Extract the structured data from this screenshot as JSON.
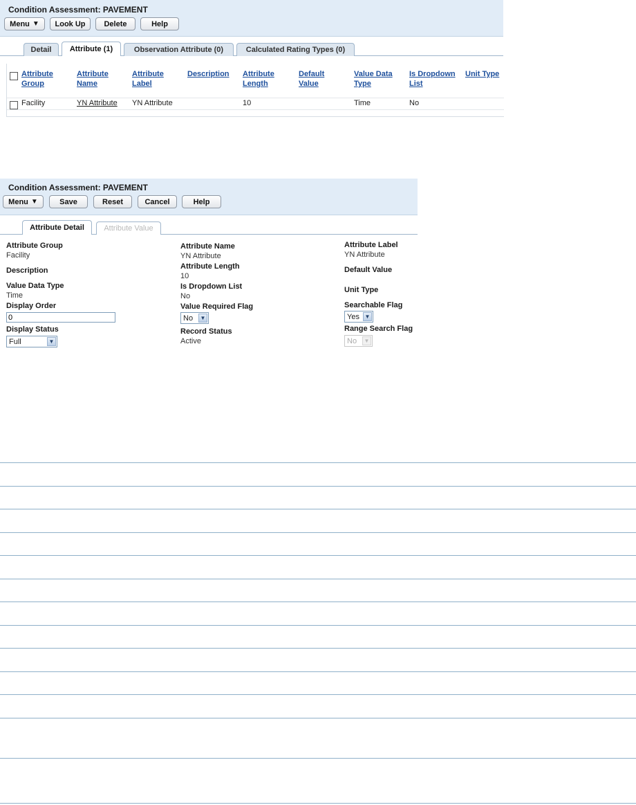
{
  "panel1": {
    "title": "Condition Assessment: PAVEMENT",
    "buttons": {
      "menu": "Menu",
      "lookup": "Look Up",
      "delete": "Delete",
      "help": "Help"
    },
    "tabs": [
      "Detail",
      "Attribute (1)",
      "Observation Attribute (0)",
      "Calculated Rating Types (0)"
    ],
    "columns": [
      {
        "line1": "Attribute",
        "line2": "Group"
      },
      {
        "line1": "Attribute",
        "line2": "Name"
      },
      {
        "line1": "Attribute",
        "line2": "Label"
      },
      {
        "line1": "Description",
        "line2": ""
      },
      {
        "line1": "Attribute",
        "line2": "Length"
      },
      {
        "line1": "Default",
        "line2": "Value"
      },
      {
        "line1": "Value Data",
        "line2": "Type"
      },
      {
        "line1": "Is Dropdown",
        "line2": "List"
      },
      {
        "line1": "Unit Type",
        "line2": ""
      }
    ],
    "row": {
      "group": "Facility",
      "name": "YN Attribute",
      "label": "YN Attribute",
      "description": "",
      "length": "10",
      "default_value": "",
      "data_type": "Time",
      "dropdown": "No",
      "unit_type": ""
    }
  },
  "panel2": {
    "title": "Condition Assessment: PAVEMENT",
    "buttons": {
      "menu": "Menu",
      "save": "Save",
      "reset": "Reset",
      "cancel": "Cancel",
      "help": "Help"
    },
    "tabs": [
      "Attribute Detail",
      "Attribute Value"
    ],
    "fields": {
      "attribute_group": {
        "label": "Attribute Group",
        "value": "Facility"
      },
      "attribute_name": {
        "label": "Attribute Name",
        "value": "YN Attribute"
      },
      "attribute_label": {
        "label": "Attribute Label",
        "value": "YN Attribute"
      },
      "description": {
        "label": "Description",
        "value": ""
      },
      "attribute_length": {
        "label": "Attribute Length",
        "value": "10"
      },
      "default_value": {
        "label": "Default Value",
        "value": ""
      },
      "value_data_type": {
        "label": "Value Data Type",
        "value": "Time"
      },
      "is_dropdown_list": {
        "label": "Is Dropdown List",
        "value": "No"
      },
      "unit_type": {
        "label": "Unit Type",
        "value": ""
      },
      "display_order": {
        "label": "Display Order",
        "value": "0"
      },
      "value_required_flag": {
        "label": "Value Required Flag",
        "value": "No"
      },
      "searchable_flag": {
        "label": "Searchable Flag",
        "value": "Yes"
      },
      "display_status": {
        "label": "Display Status",
        "value": "Full"
      },
      "record_status": {
        "label": "Record Status",
        "value": "Active"
      },
      "range_search_flag": {
        "label": "Range Search Flag",
        "value": "No"
      }
    }
  },
  "icons": {
    "menu_arrow": "menu-dropdown-icon",
    "select_arrow": "chevron-down-icon"
  },
  "colors": {
    "header_bg": "#e1ecf7",
    "link": "#1d4f9c",
    "rule_line": "#8fb0c9"
  }
}
